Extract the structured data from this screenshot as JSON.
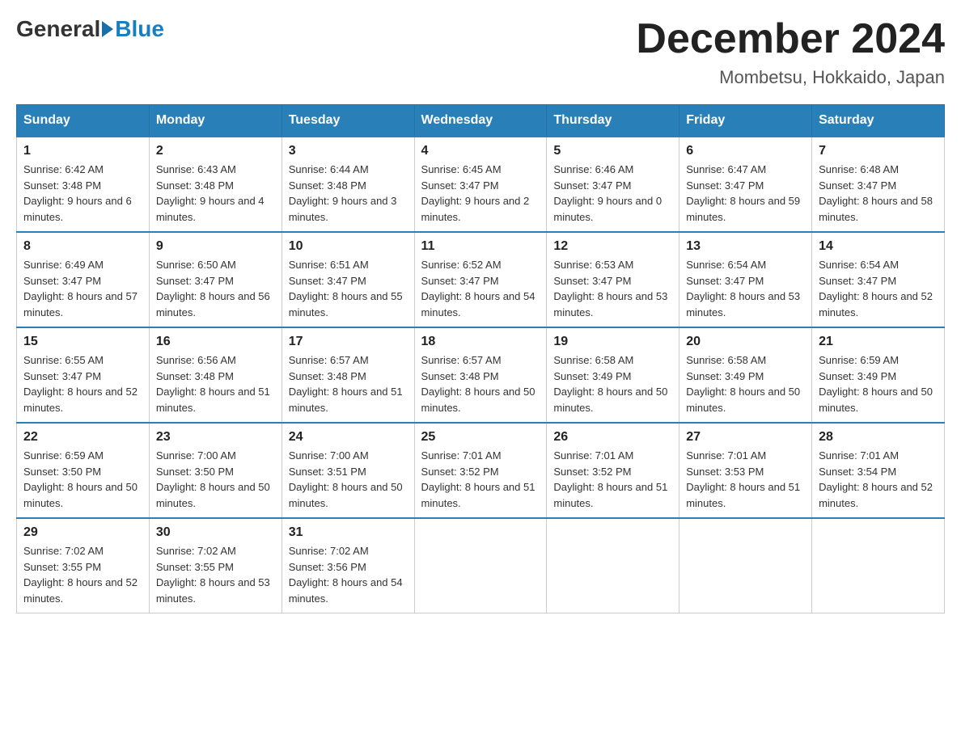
{
  "header": {
    "logo_general": "General",
    "logo_blue": "Blue",
    "title": "December 2024",
    "subtitle": "Mombetsu, Hokkaido, Japan"
  },
  "days_of_week": [
    "Sunday",
    "Monday",
    "Tuesday",
    "Wednesday",
    "Thursday",
    "Friday",
    "Saturday"
  ],
  "weeks": [
    [
      {
        "day": "1",
        "sunrise": "6:42 AM",
        "sunset": "3:48 PM",
        "daylight": "9 hours and 6 minutes."
      },
      {
        "day": "2",
        "sunrise": "6:43 AM",
        "sunset": "3:48 PM",
        "daylight": "9 hours and 4 minutes."
      },
      {
        "day": "3",
        "sunrise": "6:44 AM",
        "sunset": "3:48 PM",
        "daylight": "9 hours and 3 minutes."
      },
      {
        "day": "4",
        "sunrise": "6:45 AM",
        "sunset": "3:47 PM",
        "daylight": "9 hours and 2 minutes."
      },
      {
        "day": "5",
        "sunrise": "6:46 AM",
        "sunset": "3:47 PM",
        "daylight": "9 hours and 0 minutes."
      },
      {
        "day": "6",
        "sunrise": "6:47 AM",
        "sunset": "3:47 PM",
        "daylight": "8 hours and 59 minutes."
      },
      {
        "day": "7",
        "sunrise": "6:48 AM",
        "sunset": "3:47 PM",
        "daylight": "8 hours and 58 minutes."
      }
    ],
    [
      {
        "day": "8",
        "sunrise": "6:49 AM",
        "sunset": "3:47 PM",
        "daylight": "8 hours and 57 minutes."
      },
      {
        "day": "9",
        "sunrise": "6:50 AM",
        "sunset": "3:47 PM",
        "daylight": "8 hours and 56 minutes."
      },
      {
        "day": "10",
        "sunrise": "6:51 AM",
        "sunset": "3:47 PM",
        "daylight": "8 hours and 55 minutes."
      },
      {
        "day": "11",
        "sunrise": "6:52 AM",
        "sunset": "3:47 PM",
        "daylight": "8 hours and 54 minutes."
      },
      {
        "day": "12",
        "sunrise": "6:53 AM",
        "sunset": "3:47 PM",
        "daylight": "8 hours and 53 minutes."
      },
      {
        "day": "13",
        "sunrise": "6:54 AM",
        "sunset": "3:47 PM",
        "daylight": "8 hours and 53 minutes."
      },
      {
        "day": "14",
        "sunrise": "6:54 AM",
        "sunset": "3:47 PM",
        "daylight": "8 hours and 52 minutes."
      }
    ],
    [
      {
        "day": "15",
        "sunrise": "6:55 AM",
        "sunset": "3:47 PM",
        "daylight": "8 hours and 52 minutes."
      },
      {
        "day": "16",
        "sunrise": "6:56 AM",
        "sunset": "3:48 PM",
        "daylight": "8 hours and 51 minutes."
      },
      {
        "day": "17",
        "sunrise": "6:57 AM",
        "sunset": "3:48 PM",
        "daylight": "8 hours and 51 minutes."
      },
      {
        "day": "18",
        "sunrise": "6:57 AM",
        "sunset": "3:48 PM",
        "daylight": "8 hours and 50 minutes."
      },
      {
        "day": "19",
        "sunrise": "6:58 AM",
        "sunset": "3:49 PM",
        "daylight": "8 hours and 50 minutes."
      },
      {
        "day": "20",
        "sunrise": "6:58 AM",
        "sunset": "3:49 PM",
        "daylight": "8 hours and 50 minutes."
      },
      {
        "day": "21",
        "sunrise": "6:59 AM",
        "sunset": "3:49 PM",
        "daylight": "8 hours and 50 minutes."
      }
    ],
    [
      {
        "day": "22",
        "sunrise": "6:59 AM",
        "sunset": "3:50 PM",
        "daylight": "8 hours and 50 minutes."
      },
      {
        "day": "23",
        "sunrise": "7:00 AM",
        "sunset": "3:50 PM",
        "daylight": "8 hours and 50 minutes."
      },
      {
        "day": "24",
        "sunrise": "7:00 AM",
        "sunset": "3:51 PM",
        "daylight": "8 hours and 50 minutes."
      },
      {
        "day": "25",
        "sunrise": "7:01 AM",
        "sunset": "3:52 PM",
        "daylight": "8 hours and 51 minutes."
      },
      {
        "day": "26",
        "sunrise": "7:01 AM",
        "sunset": "3:52 PM",
        "daylight": "8 hours and 51 minutes."
      },
      {
        "day": "27",
        "sunrise": "7:01 AM",
        "sunset": "3:53 PM",
        "daylight": "8 hours and 51 minutes."
      },
      {
        "day": "28",
        "sunrise": "7:01 AM",
        "sunset": "3:54 PM",
        "daylight": "8 hours and 52 minutes."
      }
    ],
    [
      {
        "day": "29",
        "sunrise": "7:02 AM",
        "sunset": "3:55 PM",
        "daylight": "8 hours and 52 minutes."
      },
      {
        "day": "30",
        "sunrise": "7:02 AM",
        "sunset": "3:55 PM",
        "daylight": "8 hours and 53 minutes."
      },
      {
        "day": "31",
        "sunrise": "7:02 AM",
        "sunset": "3:56 PM",
        "daylight": "8 hours and 54 minutes."
      },
      null,
      null,
      null,
      null
    ]
  ]
}
